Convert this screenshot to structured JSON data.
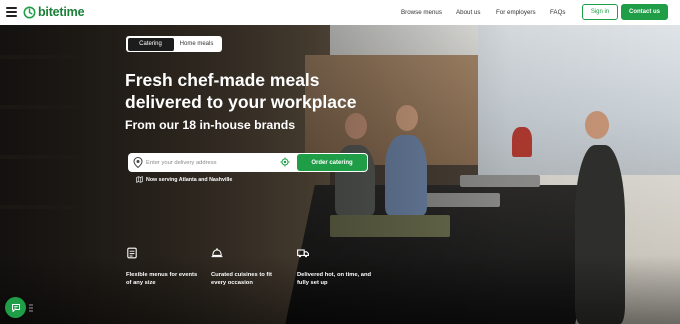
{
  "brand": {
    "name": "bitetime",
    "color": "#1f9d47"
  },
  "nav": {
    "links": [
      "Browse menus",
      "About us",
      "For employers",
      "FAQs"
    ],
    "signin_label": "Sign in",
    "contact_label": "Contact us"
  },
  "hero": {
    "tabs": [
      {
        "label": "Catering",
        "active": true
      },
      {
        "label": "Home meals",
        "active": false
      }
    ],
    "headline_line1": "Fresh chef-made meals",
    "headline_line2": "delivered to your workplace",
    "subheadline": "From our 18 in-house brands",
    "search": {
      "placeholder": "Enter your delivery address",
      "value": ""
    },
    "order_label": "Order catering",
    "serving_text": "Now serving Atlanta and Nashville"
  },
  "features": [
    {
      "icon": "menu-card-icon",
      "line1": "Flexible menus for events",
      "line2": "of any size"
    },
    {
      "icon": "cloche-icon",
      "line1": "Curated cuisines to fit",
      "line2": "every occasion"
    },
    {
      "icon": "delivery-truck-icon",
      "line1": "Delivered hot, on time, and",
      "line2": "fully set up"
    }
  ],
  "icons": [
    "menu-icon",
    "bitetime-logo-icon",
    "map-pin-icon",
    "locate-icon",
    "map-icon",
    "chat-icon",
    "drag-handle-icon"
  ]
}
